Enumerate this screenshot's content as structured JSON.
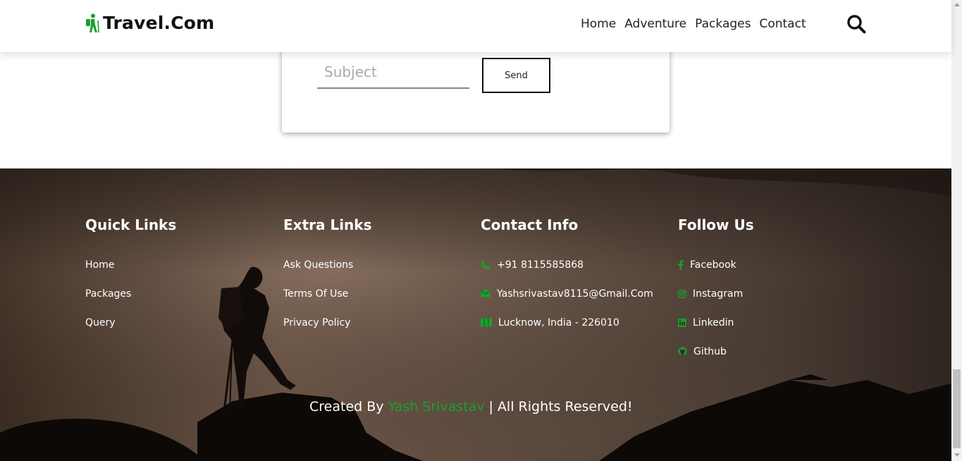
{
  "header": {
    "logo_text": "Travel.Com",
    "nav": [
      "Home",
      "Adventure",
      "Packages",
      "Contact"
    ]
  },
  "form": {
    "subject_placeholder": "Subject",
    "send_label": "Send"
  },
  "footer": {
    "quick_links": {
      "title": "Quick Links",
      "items": [
        "Home",
        "Packages",
        "Query"
      ]
    },
    "extra_links": {
      "title": "Extra Links",
      "items": [
        "Ask Questions",
        "Terms Of Use",
        "Privacy Policy"
      ]
    },
    "contact": {
      "title": "Contact Info",
      "phone": "+91 8115585868",
      "email": "Yashsrivastav8115@Gmail.Com",
      "address": "Lucknow, India - 226010"
    },
    "follow": {
      "title": "Follow Us",
      "items": [
        "Facebook",
        "Instagram",
        "Linkedin",
        "Github"
      ]
    },
    "credit": {
      "prefix": "Created By ",
      "author": "Yash Srivastav",
      "suffix": " | All Rights Reserved!"
    }
  },
  "colors": {
    "accent": "#1b9e2f",
    "text_dark": "#111111"
  }
}
